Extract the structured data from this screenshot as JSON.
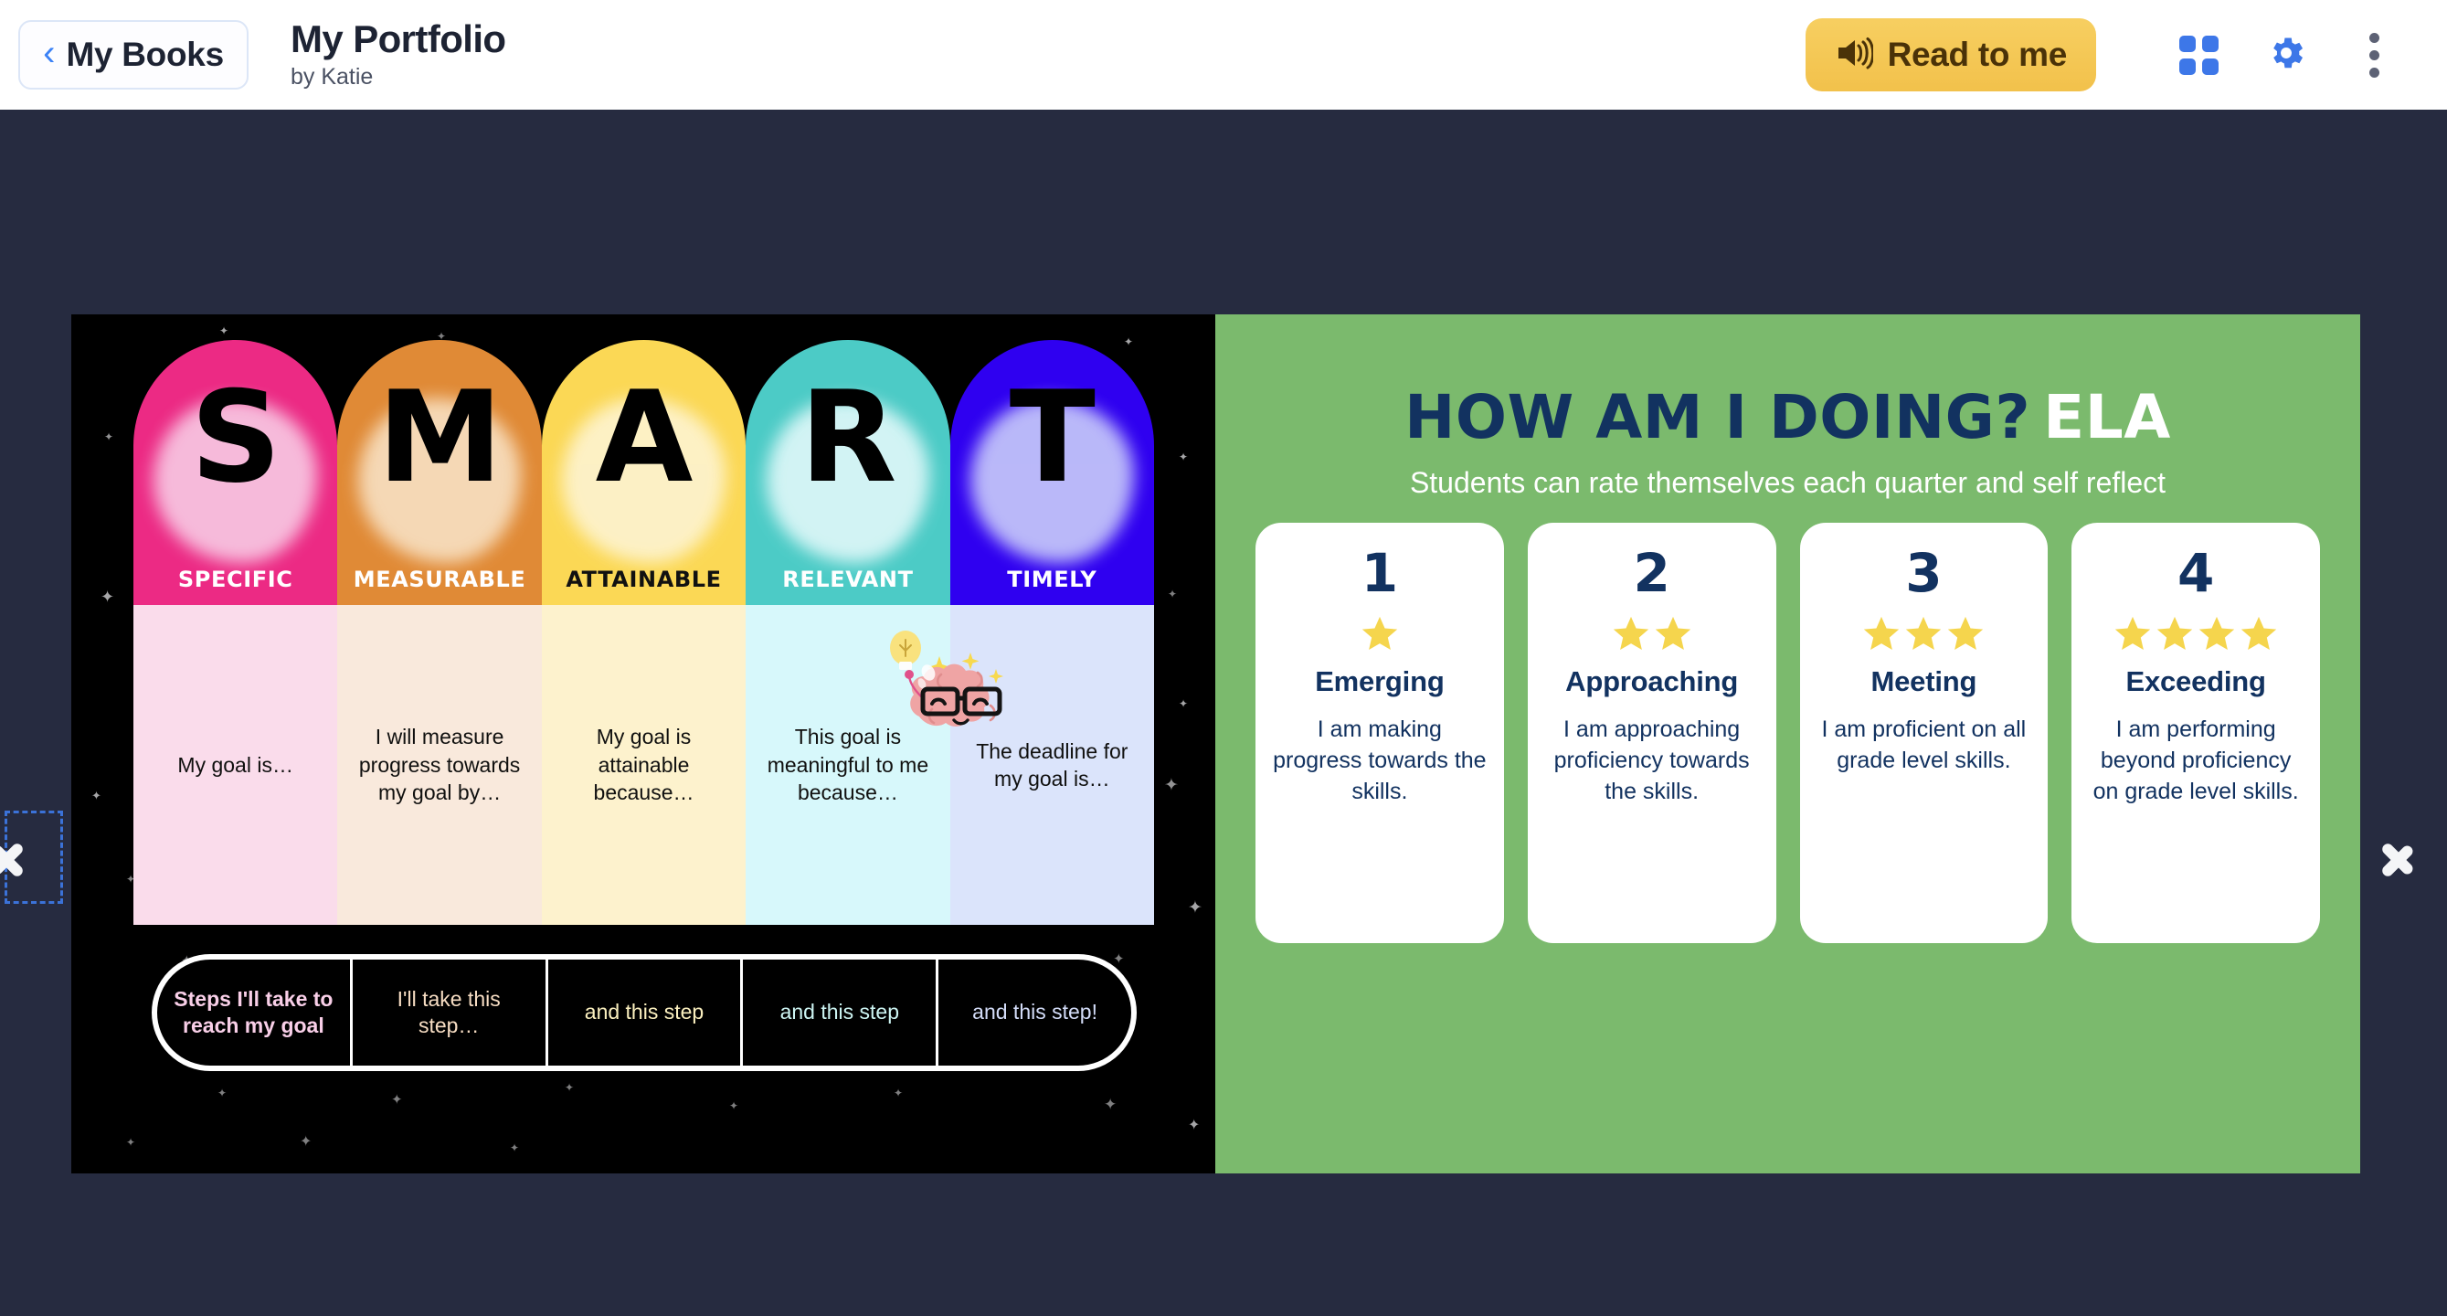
{
  "header": {
    "back_button": {
      "label": "My Books",
      "icon": "chevron-left-icon"
    },
    "title": "My Portfolio",
    "author": "by Katie",
    "read_button": {
      "label": "Read to me",
      "icon": "speaker-icon"
    },
    "grid_icon": "grid-view-icon",
    "settings_icon": "gear-icon",
    "more_icon": "kebab-menu-icon"
  },
  "nav": {
    "prev_label": "Previous page",
    "next_label": "Next page",
    "prev_icon": "chevron-left-icon",
    "next_icon": "chevron-right-icon"
  },
  "colors": {
    "background": "#262b40",
    "page_left_bg": "#000000",
    "page_right_bg": "#7bba6d",
    "navy": "#123260",
    "star": "#f5d54d",
    "accent_blue": "#3d77e8",
    "read_button": "#f2c14b"
  },
  "left_page": {
    "mascot": "brain-with-glasses-and-lightbulb-illustration",
    "smart_columns": [
      {
        "letter": "S",
        "word": "SPECIFIC",
        "body": "My goal is…",
        "header_color": "#ec2a84",
        "blob_color": "#f7c7e2",
        "body_color": "#fadceb",
        "word_color": "#ffffff"
      },
      {
        "letter": "M",
        "word": "MEASURABLE",
        "body": "I will measure progress towards my goal by…",
        "header_color": "#e08a36",
        "blob_color": "#f7dfc0",
        "body_color": "#f9e9dc",
        "word_color": "#ffffff"
      },
      {
        "letter": "A",
        "word": "ATTAINABLE",
        "body": "My goal is attainable because…",
        "header_color": "#fbd855",
        "blob_color": "#fdf3cf",
        "body_color": "#fdf2cd",
        "word_color": "#111111"
      },
      {
        "letter": "R",
        "word": "RELEVANT",
        "body": "This goal is meaningful to me because…",
        "header_color": "#4ccbc6",
        "blob_color": "#def7f8",
        "body_color": "#d7f8fb",
        "word_color": "#ffffff"
      },
      {
        "letter": "T",
        "word": "TIMELY",
        "body": "The deadline for my goal is…",
        "header_color": "#2f00f0",
        "blob_color": "#c6c8fa",
        "body_color": "#dbe4fb",
        "word_color": "#ffffff"
      }
    ],
    "steps": [
      {
        "text": "Steps I'll take to reach my goal",
        "color": "#f9cfe8",
        "bold": true
      },
      {
        "text": "I'll take this step…",
        "color": "#f7ddc3",
        "bold": false
      },
      {
        "text": "and this step",
        "color": "#fbf0bf",
        "bold": false
      },
      {
        "text": "and this step",
        "color": "#cdf5f3",
        "bold": false
      },
      {
        "text": "and this step!",
        "color": "#d3dcf8",
        "bold": false
      }
    ]
  },
  "right_page": {
    "title_main": "HOW AM I DOING?",
    "title_subject": "ELA",
    "subtitle": "Students can rate themselves each quarter and self reflect",
    "rating_cards": [
      {
        "number": "1",
        "stars": 1,
        "name": "Emerging",
        "description": "I am making progress towards the skills."
      },
      {
        "number": "2",
        "stars": 2,
        "name": "Approaching",
        "description": "I am approaching proficiency towards the skills."
      },
      {
        "number": "3",
        "stars": 3,
        "name": "Meeting",
        "description": "I am proficient on all grade level skills."
      },
      {
        "number": "4",
        "stars": 4,
        "name": "Exceeding",
        "description": "I am performing beyond proficiency on grade level skills."
      }
    ]
  }
}
